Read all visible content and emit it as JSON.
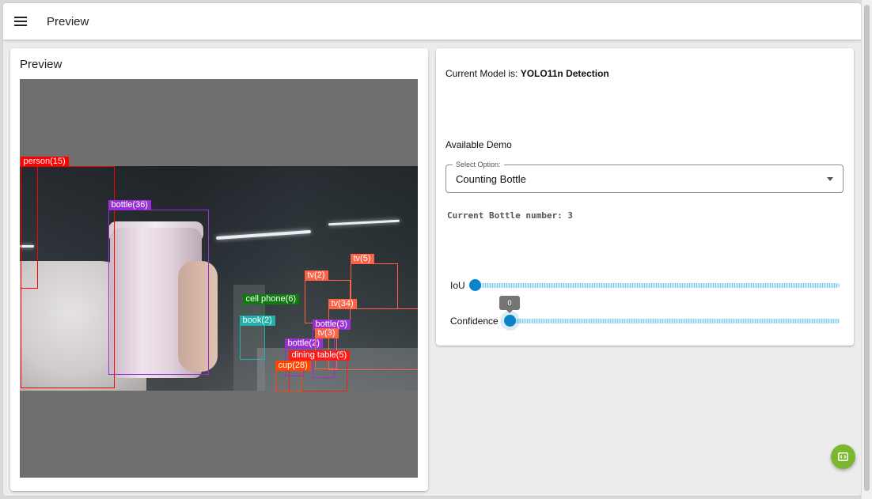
{
  "header": {
    "title": "Preview",
    "menu_icon": "hamburger-menu-icon"
  },
  "preview": {
    "title": "Preview",
    "detections": [
      {
        "label": "person(15)",
        "color": "#ff0000"
      },
      {
        "label": "bottle(36)",
        "color": "#9b2fd6"
      },
      {
        "label": "tv(5)",
        "color": "#ff6347"
      },
      {
        "label": "tv(2)",
        "color": "#ff6347"
      },
      {
        "label": "tv(34)",
        "color": "#ff6347"
      },
      {
        "label": "cell phone(6)",
        "color": "#0f7a0f"
      },
      {
        "label": "book(2)",
        "color": "#20b2aa"
      },
      {
        "label": "bottle(3)",
        "color": "#9b2fd6"
      },
      {
        "label": "bottle(2)",
        "color": "#9b2fd6"
      },
      {
        "label": "tv(3)",
        "color": "#ff6347"
      },
      {
        "label": "dining table(5)",
        "color": "#ff1a1a"
      },
      {
        "label": "cup(28)",
        "color": "#ff4500"
      }
    ]
  },
  "panel": {
    "model_prefix": "Current Model is:",
    "model_name": "YOLO11n Detection",
    "available_demo_label": "Available Demo",
    "select": {
      "legend": "Select Option:",
      "value": "Counting Bottle"
    },
    "bottle_count_text": "Current Bottle number: 3",
    "iou": {
      "label": "IoU",
      "value": 0
    },
    "confidence": {
      "label": "Confidence",
      "value": 0,
      "tooltip": "0"
    }
  },
  "fab_icon": "code-icon",
  "colors": {
    "accent": "#0a84c6",
    "fab": "#7cb82f"
  }
}
